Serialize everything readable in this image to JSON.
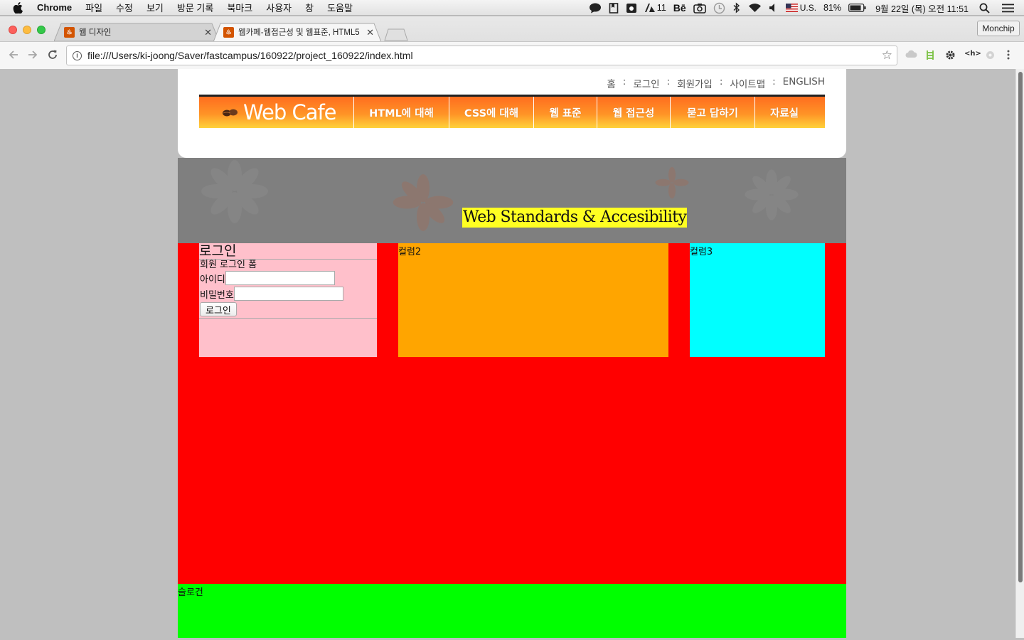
{
  "menubar": {
    "app_name": "Chrome",
    "menus": [
      "파일",
      "수정",
      "보기",
      "방문 기록",
      "북마크",
      "사용자",
      "창",
      "도움말"
    ],
    "status": {
      "adobe_count": "11",
      "behance": "Bē",
      "input_source": "U.S.",
      "battery": "81%",
      "clock": "9월 22일 (목) 오전  11:51"
    }
  },
  "browser": {
    "tabs": [
      {
        "title": "웹 디자인",
        "active": false
      },
      {
        "title": "웹카페-웹접근성 및 웹표준, HTML5",
        "active": true
      }
    ],
    "profile_button": "Monchip",
    "url": "file:///Users/ki-joong/Saver/fastcampus/160922/project_160922/index.html"
  },
  "page": {
    "util_nav": [
      "홈",
      "로그인",
      "회원가입",
      "사이트맵",
      "ENGLISH"
    ],
    "logo_text": "Web Cafe",
    "gnb": [
      "HTML에 대해",
      "CSS에 대해",
      "웹 표준",
      "웹 접근성",
      "묻고 답하기",
      "자료실"
    ],
    "visual_title": "Web Standards & Accesibility",
    "login": {
      "heading": "로그인",
      "legend": "회원 로그인 폼",
      "id_label": "아이디",
      "id_value": "",
      "pw_label": "비밀번호",
      "pw_value": "",
      "submit": "로그인"
    },
    "column2": "컬럼2",
    "column3": "컬럼3",
    "footer": "슬로건"
  },
  "colors": {
    "content_bg": "#ff0000",
    "column1_bg": "#ffc0cb",
    "column2_bg": "#ffa500",
    "column3_bg": "#00ffff",
    "footer_bg": "#00ff00",
    "visual_bg": "#7f7f7f",
    "title_highlight": "#ffff22",
    "gnb_gradient_top": "#ff6d1f",
    "gnb_gradient_bottom": "#ffd23a"
  }
}
